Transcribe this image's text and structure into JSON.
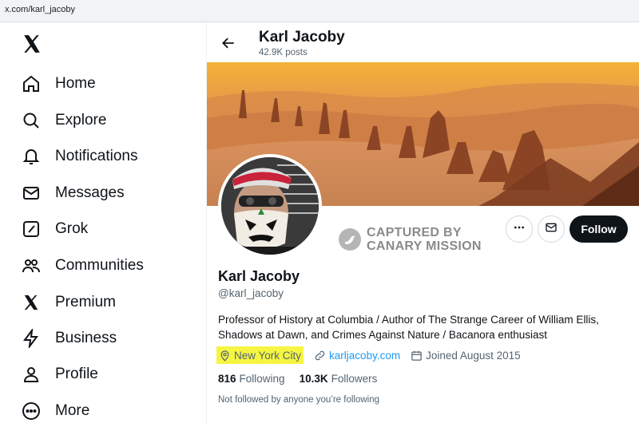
{
  "browser": {
    "url": "x.com/karl_jacoby"
  },
  "sidebar": {
    "items": [
      {
        "label": "Home",
        "icon": "home-icon"
      },
      {
        "label": "Explore",
        "icon": "search-icon"
      },
      {
        "label": "Notifications",
        "icon": "bell-icon"
      },
      {
        "label": "Messages",
        "icon": "envelope-icon"
      },
      {
        "label": "Grok",
        "icon": "grok-icon"
      },
      {
        "label": "Communities",
        "icon": "people-icon"
      },
      {
        "label": "Premium",
        "icon": "x-icon"
      },
      {
        "label": "Business",
        "icon": "lightning-icon"
      },
      {
        "label": "Profile",
        "icon": "person-icon"
      },
      {
        "label": "More",
        "icon": "more-circle-icon"
      }
    ]
  },
  "header": {
    "name": "Karl Jacoby",
    "posts": "42.9K posts"
  },
  "watermark": {
    "line1": "CAPTURED BY",
    "line2": "CANARY MISSION"
  },
  "actions": {
    "follow": "Follow"
  },
  "profile": {
    "name": "Karl Jacoby",
    "handle": "@karl_jacoby",
    "bio": "Professor of History at Columbia / Author of The Strange Career of William Ellis, Shadows at Dawn, and Crimes Against Nature / Bacanora enthusiast",
    "location": "New York City",
    "website": "karljacoby.com",
    "joined": "Joined August 2015",
    "following_count": "816",
    "following_label": "Following",
    "followers_count": "10.3K",
    "followers_label": "Followers",
    "not_followed": "Not followed by anyone you’re following"
  },
  "colors": {
    "accent": "#1d9bf0",
    "highlight": "#f5f542",
    "follow_button": "#0f1419"
  }
}
